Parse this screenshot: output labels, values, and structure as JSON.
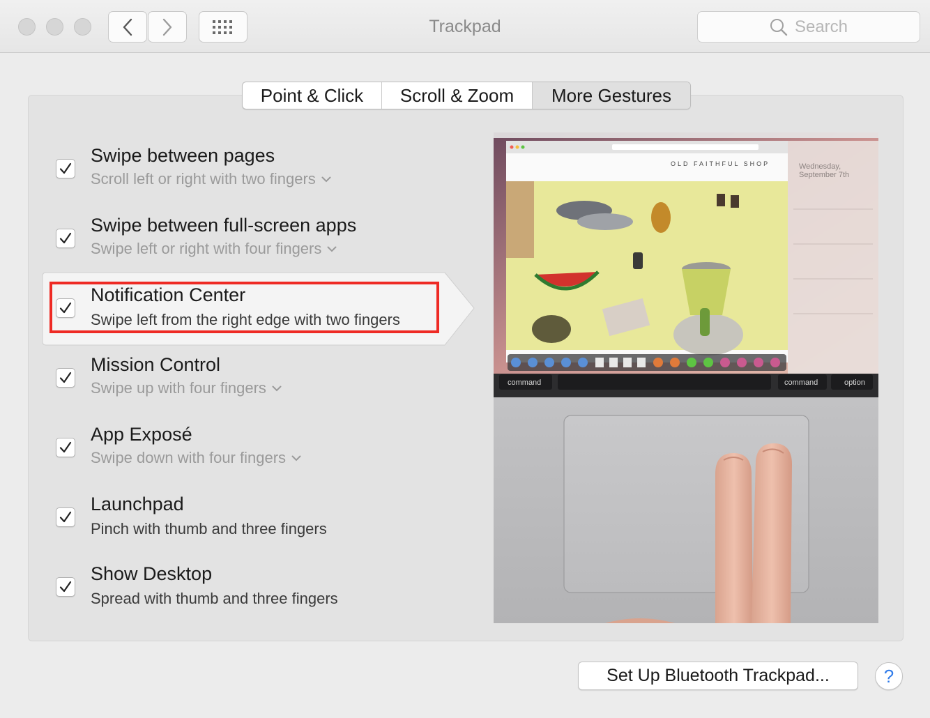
{
  "window": {
    "title": "Trackpad"
  },
  "toolbar": {
    "search_placeholder": "Search"
  },
  "tabs": [
    {
      "label": "Point & Click",
      "active": false
    },
    {
      "label": "Scroll & Zoom",
      "active": false
    },
    {
      "label": "More Gestures",
      "active": true
    }
  ],
  "gestures": [
    {
      "title": "Swipe between pages",
      "subtitle": "Scroll left or right with two fingers",
      "checked": true,
      "has_menu": true
    },
    {
      "title": "Swipe between full-screen apps",
      "subtitle": "Swipe left or right with four fingers",
      "checked": true,
      "has_menu": true
    },
    {
      "title": "Notification Center",
      "subtitle": "Swipe left from the right edge with two fingers",
      "checked": true,
      "has_menu": false,
      "selected": true
    },
    {
      "title": "Mission Control",
      "subtitle": "Swipe up with four fingers",
      "checked": true,
      "has_menu": true
    },
    {
      "title": "App Exposé",
      "subtitle": "Swipe down with four fingers",
      "checked": true,
      "has_menu": true
    },
    {
      "title": "Launchpad",
      "subtitle": "Pinch with thumb and three fingers",
      "checked": true,
      "has_menu": false
    },
    {
      "title": "Show Desktop",
      "subtitle": "Spread with thumb and three fingers",
      "checked": true,
      "has_menu": false
    }
  ],
  "preview": {
    "site_name": "OLD FAITHFUL SHOP",
    "notif_date_line1": "Wednesday,",
    "notif_date_line2": "September 7th",
    "keys": {
      "command_left": "command",
      "command_right": "command",
      "option": "option"
    }
  },
  "footer": {
    "bluetooth_button": "Set Up Bluetooth Trackpad...",
    "help": "?"
  },
  "colors": {
    "highlight": "#ee2a24",
    "help_blue": "#2f7bea"
  }
}
